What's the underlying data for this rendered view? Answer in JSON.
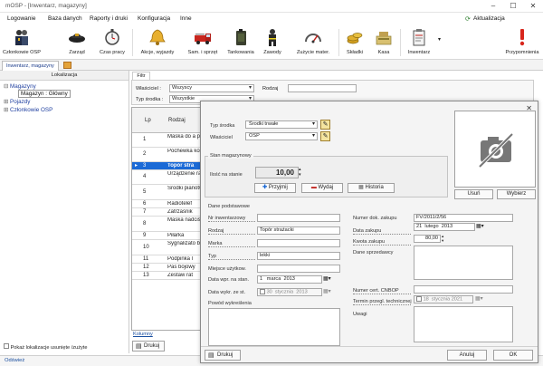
{
  "window": {
    "title": "mOSP - [Inwentarz, magazyny]",
    "minimize": "–",
    "maximize": "☐",
    "close": "✕"
  },
  "menu": [
    "Logowanie",
    "Baza danych",
    "Raporty i druki",
    "Konfiguracja",
    "Inne"
  ],
  "update_label": "Aktualizacja",
  "toolbar": [
    {
      "label": "Członkowie OSP",
      "icon": "members-icon"
    },
    {
      "label": "Zarząd",
      "icon": "board-icon"
    },
    {
      "label": "Czas pracy",
      "icon": "stopwatch-icon"
    },
    {
      "label": "Akcje, wyjazdy",
      "icon": "bell-icon"
    },
    {
      "label": "Sam. i sprzęt",
      "icon": "fire-truck-icon"
    },
    {
      "label": "Tankowania",
      "icon": "fuel-can-icon"
    },
    {
      "label": "Zawody",
      "icon": "firefighter-icon"
    },
    {
      "label": "Zużycie mater.",
      "icon": "gauge-icon"
    },
    {
      "label": "Składki",
      "icon": "coins-icon"
    },
    {
      "label": "Kasa",
      "icon": "cash-register-icon"
    },
    {
      "label": "Inwentarz",
      "icon": "clipboard-icon"
    },
    {
      "label": "Przypomnienia",
      "icon": "exclamation-icon"
    }
  ],
  "doc_tab": "Inwentarz, magazyny",
  "left_panel": {
    "header": "Lokalizacja",
    "tree": [
      {
        "label": "Magazyny",
        "level": 1,
        "toggle": "⊟"
      },
      {
        "label": "Magazyn : Główny",
        "level": 2,
        "toggle": ""
      },
      {
        "label": "Pojazdy",
        "level": 1,
        "toggle": "⊞"
      },
      {
        "label": "Członkowie OSP",
        "level": 1,
        "toggle": "⊞"
      }
    ],
    "show_deleted": "Pokaż lokalizacje usunięte /zużyte"
  },
  "status": "Odśwież",
  "filter": {
    "tab": "Filtr",
    "owner_label": "Właściciel :",
    "owner_value": "Wszyscy",
    "type_label": "Typ środka :",
    "type_value": "Wszystkie",
    "kind_label": "Rodzaj"
  },
  "grid": {
    "headers": {
      "lp": "Lp",
      "name": "Rodzaj"
    },
    "selected_marker": "▸",
    "rows": [
      {
        "lp": "1",
        "name": "Maska do a powietrzne"
      },
      {
        "lp": "2",
        "name": "Pochewka koszulę"
      },
      {
        "lp": "3",
        "name": "Topór stra"
      },
      {
        "lp": "4",
        "name": "Urządzenie ratownicze"
      },
      {
        "lp": "5",
        "name": "Środki pianotwórc"
      },
      {
        "lp": "6",
        "name": "Radiotelef"
      },
      {
        "lp": "7",
        "name": "Zatrzaśnik"
      },
      {
        "lp": "8",
        "name": "Maska nadciśnien"
      },
      {
        "lp": "9",
        "name": "Piłarka"
      },
      {
        "lp": "10",
        "name": "Sygnalizato bezruchu"
      },
      {
        "lp": "11",
        "name": "Podpinka l"
      },
      {
        "lp": "12",
        "name": "Pas bojowy"
      },
      {
        "lp": "13",
        "name": "Zestaw rat"
      }
    ],
    "columns_link": "Kolumny",
    "print": "Drukuj"
  },
  "dialog": {
    "close": "✕",
    "type_label": "Typ środka",
    "type_value": "Środki trwałe",
    "owner_label": "Właściciel",
    "owner_value": "OSP",
    "stock_group": "Stan magazynowy",
    "qty_label": "Ilość na stanie",
    "qty_value": "10,00",
    "btn_receive": "Przyjmij",
    "btn_issue": "Wydaj",
    "btn_history": "Historia",
    "btn_take": "Usuń",
    "btn_choose": "Wybierz",
    "basic_data": "Dane podstawowe",
    "inv_no_label": "Nr inwentarzowy",
    "kind_label": "Rodzaj",
    "kind_value": "Topór strażacki",
    "brand_label": "Marka",
    "type2_label": "Typ",
    "type2_value": "lekki",
    "location_label": "Miejsce użytkow.",
    "date_in_label": "Data wpr. na stan.",
    "date_in": {
      "day": "1",
      "month": "marca",
      "year": "2013"
    },
    "date_out_label": "Data wykr. ze st.",
    "date_out": {
      "day": "30",
      "month": "stycznia",
      "year": "2013"
    },
    "reason_label": "Powód wykreślenia",
    "doc_no_label": "Numer dok. zakupu",
    "doc_no_value": "FV/2011/2/56",
    "buy_date_label": "Data zakupu",
    "buy_date": {
      "day": "21",
      "month": "lutego",
      "year": "2013"
    },
    "amount_label": "Kwota zakupu",
    "amount_value": "80,00",
    "seller_label": "Dane sprzedawcy",
    "cert_label": "Numer cert. CNBOP",
    "inspection_label": "Termin przegl. technicznej",
    "inspection_date": {
      "day": "18",
      "month": "stycznia",
      "year": "2021"
    },
    "notes_label": "Uwagi",
    "print": "Drukuj",
    "cancel": "Anuluj",
    "ok": "OK"
  },
  "colors": {
    "selection": "#1b6ad6",
    "tree_link": "#2040a0",
    "dialog_bg": "#f4f4f4"
  }
}
